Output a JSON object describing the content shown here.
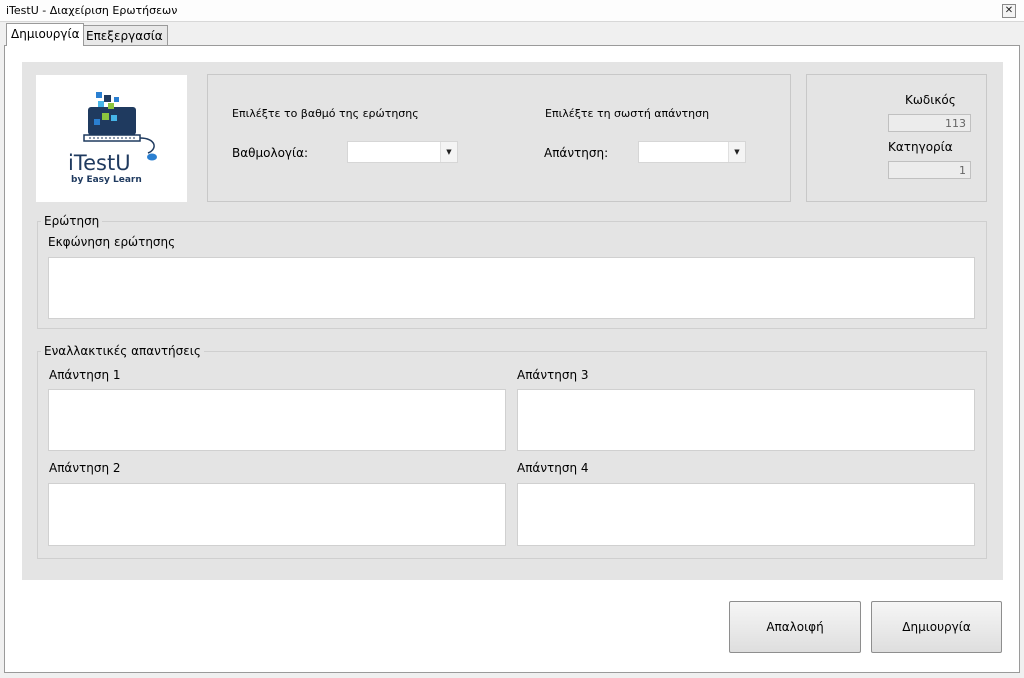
{
  "window": {
    "title": "iTestU - Διαχείριση Ερωτήσεων",
    "close_glyph": "✕"
  },
  "tabs": [
    {
      "label": "Δημιουργία",
      "active": true
    },
    {
      "label": "Επεξεργασία",
      "active": false
    }
  ],
  "logo": {
    "name": "iTestU",
    "tagline": "by Easy Learn"
  },
  "grade": {
    "prompt": "Επιλέξτε το βαθμό της ερώτησης",
    "label": "Βαθμολογία:",
    "value": ""
  },
  "answer": {
    "prompt": "Επιλέξτε τη σωστή απάντηση",
    "label": "Απάντηση:",
    "value": ""
  },
  "info": {
    "code_label": "Κωδικός",
    "code_value": "113",
    "category_label": "Κατηγορία",
    "category_value": "1"
  },
  "question": {
    "legend": "Ερώτηση",
    "label": "Εκφώνηση ερώτησης",
    "value": ""
  },
  "alternatives": {
    "legend": "Εναλλακτικές απαντήσεις",
    "a1_label": "Απάντηση 1",
    "a2_label": "Απάντηση 2",
    "a3_label": "Απάντηση 3",
    "a4_label": "Απάντηση 4"
  },
  "buttons": {
    "clear": "Απαλοιφή",
    "create": "Δημιουργία"
  },
  "colors": {
    "logo_dark": "#1f3a5f",
    "accent_blue": "#2a7fd1"
  }
}
